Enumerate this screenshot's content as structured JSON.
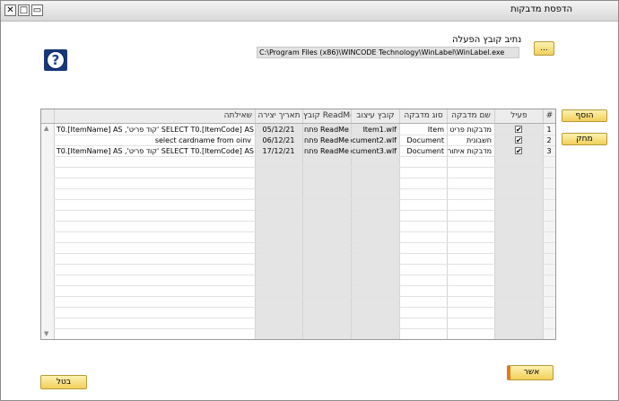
{
  "window": {
    "title": "הדפסת מדבקות"
  },
  "title_buttons": {
    "close": "✕",
    "maximize": "□",
    "minimize": "▭"
  },
  "path": {
    "label": "נתיב קובץ הפעלה",
    "value": "C:\\Program Files (x86)\\WINCODE Technology\\WinLabel\\WinLabel.exe",
    "browse": "..."
  },
  "buttons": {
    "add": "הוסף",
    "delete": "מחק",
    "ok": "אשר",
    "cancel": "בטל"
  },
  "columns": [
    "#",
    "פעיל",
    "שם מדבקה",
    "סוג מדבקה",
    "קובץ עיצוב",
    "קובץ ReadMe",
    "תאריך יצירה",
    "שאילתה"
  ],
  "rows": [
    {
      "num": "1",
      "active": true,
      "name": "מדבקות פריט",
      "type": "Item",
      "design": "Item1.wlf",
      "readme": "פתח ReadMe",
      "date": "05/12/21",
      "query": "SELECT T0.[ItemCode] AS 'קוד פריט', T0.[ItemName] AS 'תאור"
    },
    {
      "num": "2",
      "active": true,
      "name": "חשבונית",
      "type": "Document",
      "design": "Document2.wlf",
      "readme": "פתח ReadMe",
      "date": "06/12/21",
      "query": "select cardname from oinv"
    },
    {
      "num": "3",
      "active": true,
      "name": "מדבקות איתור",
      "type": "Document",
      "design": "Document3.wlf",
      "readme": "פתח ReadMe",
      "date": "17/12/21",
      "query": "SELECT T0.[ItemCode] AS 'קוד פריט', T0.[ItemName] AS 'תאור"
    }
  ],
  "colors": {
    "accent": "#f2cf5a",
    "header_bg": "#ececec",
    "readonly_col": "#e4e4e4"
  }
}
